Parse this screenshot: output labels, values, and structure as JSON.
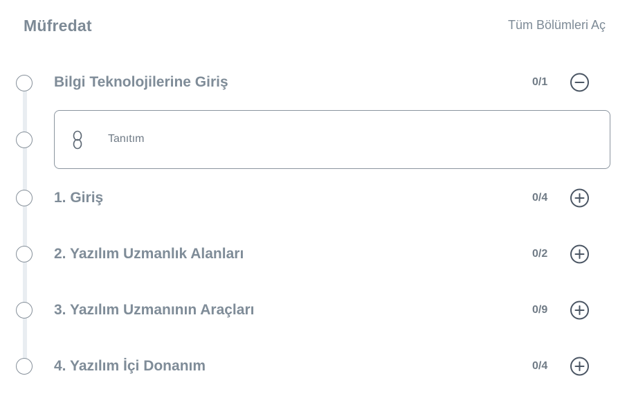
{
  "header": {
    "title": "Müfredat",
    "expand_all_label": "Tüm Bölümleri Aç"
  },
  "sections": [
    {
      "title": "Bilgi Teknolojilerine Giriş",
      "count": "0/1",
      "state": "expanded",
      "toggle_icon": "minus-circle-icon",
      "lessons": [
        {
          "title": "Tanıtım",
          "icon": "link-icon"
        }
      ]
    },
    {
      "title": "1. Giriş",
      "count": "0/4",
      "state": "collapsed",
      "toggle_icon": "plus-circle-icon"
    },
    {
      "title": "2. Yazılım Uzmanlık Alanları",
      "count": "0/2",
      "state": "collapsed",
      "toggle_icon": "plus-circle-icon"
    },
    {
      "title": "3. Yazılım Uzmanının Araçları",
      "count": "0/9",
      "state": "collapsed",
      "toggle_icon": "plus-circle-icon"
    },
    {
      "title": "4. Yazılım İçi Donanım",
      "count": "0/4",
      "state": "collapsed",
      "toggle_icon": "plus-circle-icon"
    }
  ],
  "colors": {
    "text_muted": "#7f8c98",
    "icon_dark": "#4a5563",
    "timeline": "#e9edf1",
    "border": "#8a949e"
  }
}
